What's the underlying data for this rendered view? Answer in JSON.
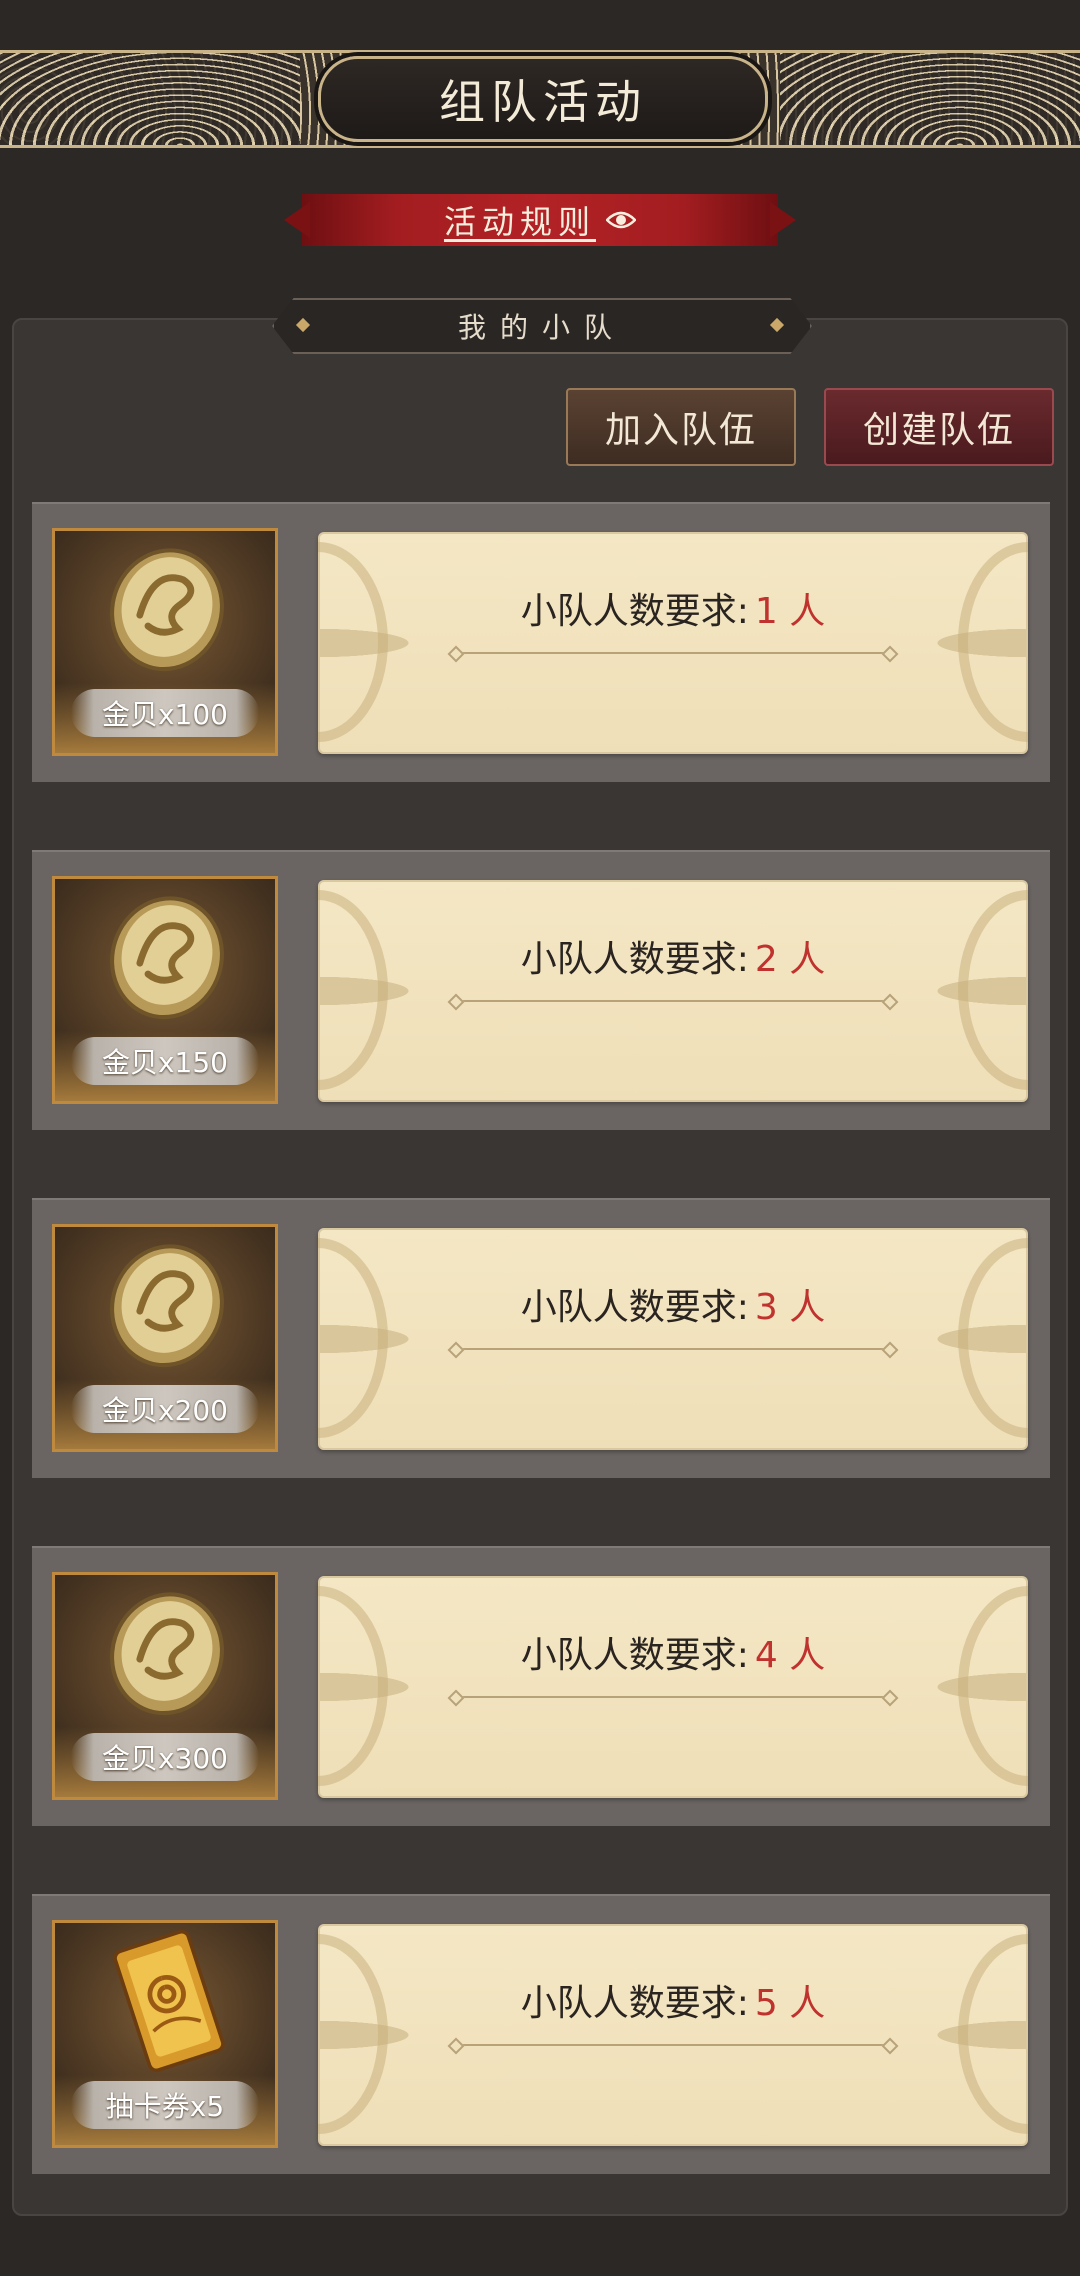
{
  "header": {
    "title": "组队活动"
  },
  "rules": {
    "label": "活动规则"
  },
  "team_section": {
    "title": "我的小队"
  },
  "actions": {
    "join_label": "加入队伍",
    "create_label": "创建队伍"
  },
  "rewards": [
    {
      "item": "金贝x100",
      "icon": "gold-coin-icon",
      "requirement_label": "小队人数要求:",
      "count": "1 人"
    },
    {
      "item": "金贝x150",
      "icon": "gold-coin-icon",
      "requirement_label": "小队人数要求:",
      "count": "2 人"
    },
    {
      "item": "金贝x200",
      "icon": "gold-coin-icon",
      "requirement_label": "小队人数要求:",
      "count": "3 人"
    },
    {
      "item": "金贝x300",
      "icon": "gold-coin-icon",
      "requirement_label": "小队人数要求:",
      "count": "4 人"
    },
    {
      "item": "抽卡券x5",
      "icon": "gacha-ticket-icon",
      "requirement_label": "小队人数要求:",
      "count": "5 人"
    }
  ],
  "colors": {
    "accent_red": "#c0322e",
    "ribbon": "#a31d20",
    "gold": "#c08a3e"
  }
}
